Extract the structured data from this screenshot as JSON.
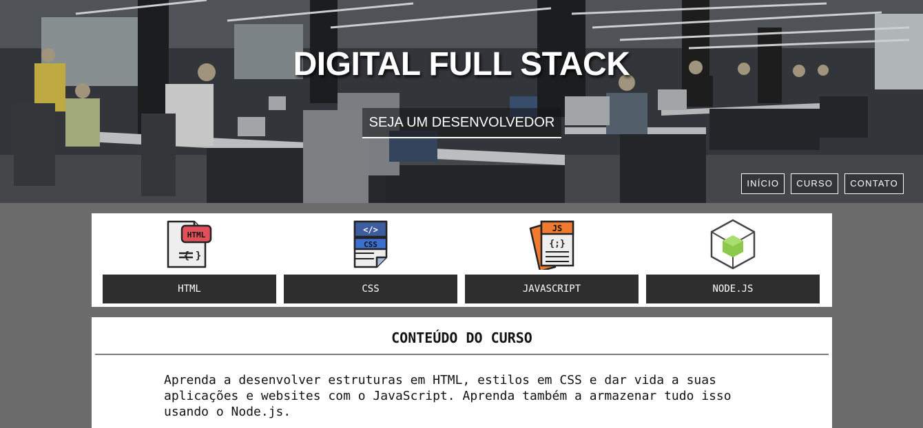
{
  "hero": {
    "title": "DIGITAL FULL STACK",
    "cta_label": "SEJA UM DESENVOLVEDOR"
  },
  "nav": {
    "items": [
      {
        "label": "INÍCIO"
      },
      {
        "label": "CURSO"
      },
      {
        "label": "CONTATO"
      }
    ]
  },
  "technologies": [
    {
      "label": "HTML",
      "icon": "html-file-icon",
      "badge": "HTML",
      "color": "#e0505a"
    },
    {
      "label": "CSS",
      "icon": "css-file-icon",
      "badge": "CSS",
      "color": "#3d6fd1"
    },
    {
      "label": "JAVASCRIPT",
      "icon": "js-file-icon",
      "badge": "JS",
      "color": "#f07a2e"
    },
    {
      "label": "NODE.JS",
      "icon": "nodejs-hexagon-icon",
      "color": "#8cc84b"
    }
  ],
  "content": {
    "title": "CONTEÚDO DO CURSO",
    "line1": "Aprenda a desenvolver estruturas em HTML, estilos em CSS e dar vida a suas",
    "line2": "aplicações e websites com o JavaScript. Aprenda também a armazenar tudo isso",
    "line3": "usando o Node.js."
  },
  "colors": {
    "page_bg": "#6b6b6b",
    "button_bg": "#2e2e2e",
    "panel_bg": "#ffffff"
  }
}
